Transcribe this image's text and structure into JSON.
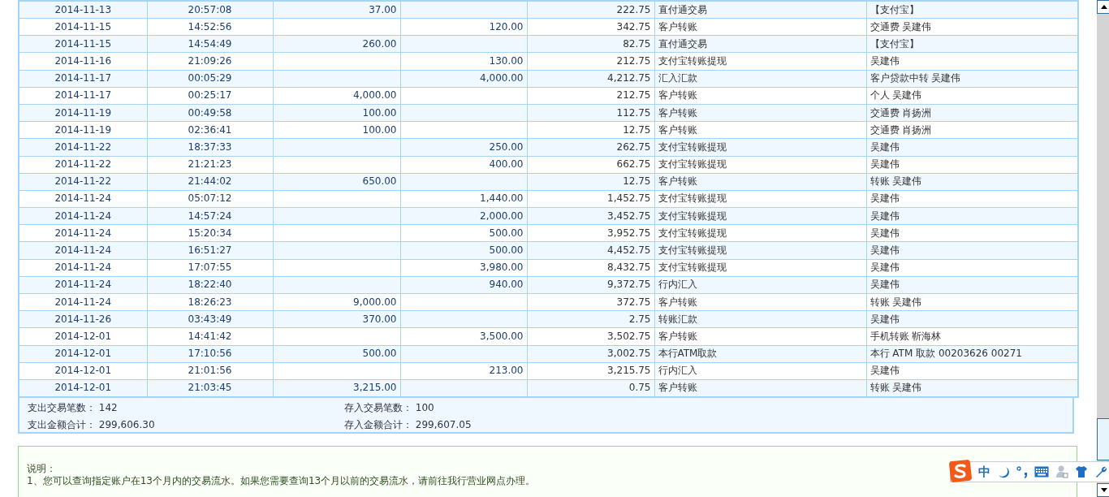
{
  "transactions": {
    "rows": [
      {
        "date": "2014-11-13",
        "time": "20:57:08",
        "debit": "37.00",
        "balance": "222.75",
        "type": "直付通交易",
        "remark": "【支付宝】"
      },
      {
        "date": "2014-11-15",
        "time": "14:52:56",
        "credit": "120.00",
        "balance": "342.75",
        "type": "客户转账",
        "remark": "交通费 吴建伟"
      },
      {
        "date": "2014-11-15",
        "time": "14:54:49",
        "debit": "260.00",
        "balance": "82.75",
        "type": "直付通交易",
        "remark": "【支付宝】"
      },
      {
        "date": "2014-11-16",
        "time": "21:09:26",
        "credit": "130.00",
        "balance": "212.75",
        "type": "支付宝转账提现",
        "remark": "吴建伟"
      },
      {
        "date": "2014-11-17",
        "time": "00:05:29",
        "credit": "4,000.00",
        "balance": "4,212.75",
        "type": "汇入汇款",
        "remark": "客户贷款中转 吴建伟"
      },
      {
        "date": "2014-11-17",
        "time": "00:25:17",
        "debit": "4,000.00",
        "balance": "212.75",
        "type": "客户转账",
        "remark": "个人 吴建伟"
      },
      {
        "date": "2014-11-19",
        "time": "00:49:58",
        "debit": "100.00",
        "balance": "112.75",
        "type": "客户转账",
        "remark": "交通费 肖扬洲"
      },
      {
        "date": "2014-11-19",
        "time": "02:36:41",
        "debit": "100.00",
        "balance": "12.75",
        "type": "客户转账",
        "remark": "交通费 肖扬洲"
      },
      {
        "date": "2014-11-22",
        "time": "18:37:33",
        "credit": "250.00",
        "balance": "262.75",
        "type": "支付宝转账提现",
        "remark": "吴建伟"
      },
      {
        "date": "2014-11-22",
        "time": "21:21:23",
        "credit": "400.00",
        "balance": "662.75",
        "type": "支付宝转账提现",
        "remark": "吴建伟"
      },
      {
        "date": "2014-11-22",
        "time": "21:44:02",
        "debit": "650.00",
        "balance": "12.75",
        "type": "客户转账",
        "remark": "转账 吴建伟"
      },
      {
        "date": "2014-11-24",
        "time": "05:07:12",
        "credit": "1,440.00",
        "balance": "1,452.75",
        "type": "支付宝转账提现",
        "remark": "吴建伟"
      },
      {
        "date": "2014-11-24",
        "time": "14:57:24",
        "credit": "2,000.00",
        "balance": "3,452.75",
        "type": "支付宝转账提现",
        "remark": "吴建伟"
      },
      {
        "date": "2014-11-24",
        "time": "15:20:34",
        "credit": "500.00",
        "balance": "3,952.75",
        "type": "支付宝转账提现",
        "remark": "吴建伟"
      },
      {
        "date": "2014-11-24",
        "time": "16:51:27",
        "credit": "500.00",
        "balance": "4,452.75",
        "type": "支付宝转账提现",
        "remark": "吴建伟"
      },
      {
        "date": "2014-11-24",
        "time": "17:07:55",
        "credit": "3,980.00",
        "balance": "8,432.75",
        "type": "支付宝转账提现",
        "remark": "吴建伟"
      },
      {
        "date": "2014-11-24",
        "time": "18:22:40",
        "credit": "940.00",
        "balance": "9,372.75",
        "type": "行内汇入",
        "remark": "吴建伟"
      },
      {
        "date": "2014-11-24",
        "time": "18:26:23",
        "debit": "9,000.00",
        "balance": "372.75",
        "type": "客户转账",
        "remark": "转账 吴建伟"
      },
      {
        "date": "2014-11-26",
        "time": "03:43:49",
        "debit": "370.00",
        "balance": "2.75",
        "type": "转账汇款",
        "remark": "吴建伟"
      },
      {
        "date": "2014-12-01",
        "time": "14:41:42",
        "credit": "3,500.00",
        "balance": "3,502.75",
        "type": "客户转账",
        "remark": "手机转账 靳海林"
      },
      {
        "date": "2014-12-01",
        "time": "17:10:56",
        "debit": "500.00",
        "balance": "3,002.75",
        "type": "本行ATM取款",
        "remark": "本行 ATM 取款 00203626 00271"
      },
      {
        "date": "2014-12-01",
        "time": "21:01:56",
        "credit": "213.00",
        "balance": "3,215.75",
        "type": "行内汇入",
        "remark": "吴建伟"
      },
      {
        "date": "2014-12-01",
        "time": "21:03:45",
        "debit": "3,215.00",
        "balance": "0.75",
        "type": "客户转账",
        "remark": "转账 吴建伟"
      }
    ]
  },
  "summary": [
    {
      "label": "支出交易笔数：",
      "value": "142"
    },
    {
      "label": "存入交易笔数：",
      "value": "100"
    },
    {
      "label": "支出金额合计：",
      "value": "299,606.30"
    },
    {
      "label": "存入金额合计：",
      "value": "299,607.05"
    }
  ],
  "notes": {
    "title": "说明：",
    "lines": [
      "1、您可以查询指定账户在13个月内的交易流水。如果您需要查询13个月以前的交易流水，请前往我行营业网点办理。"
    ]
  },
  "ime_toolbar": {
    "mode": "中"
  }
}
